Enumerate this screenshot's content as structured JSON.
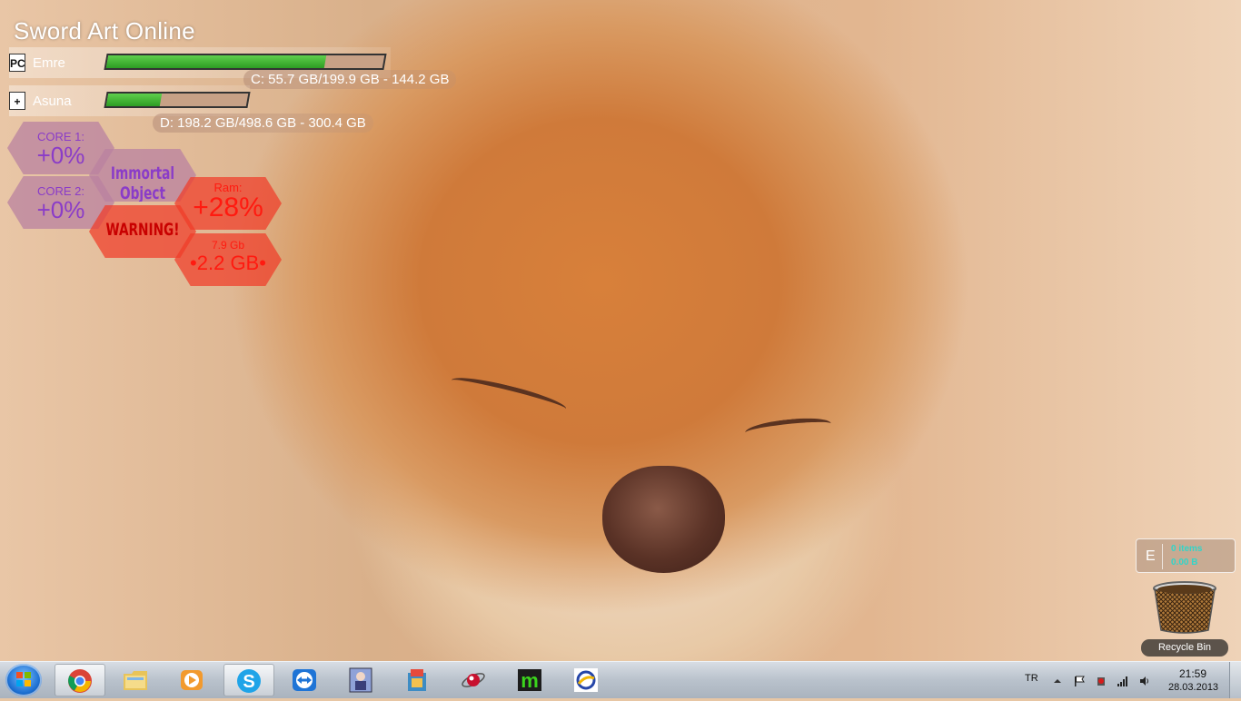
{
  "sao": {
    "title": "Sword Art Online",
    "players": [
      {
        "name": "Emre",
        "icon": "PC",
        "bar_fill": 0.79
      },
      {
        "name": "Asuna",
        "icon": "+",
        "bar_fill": 0.38
      }
    ],
    "disks": [
      {
        "text": "C: 55.7 GB/199.9 GB - 144.2 GB",
        "used_fraction": 0.28
      },
      {
        "text": "D: 198.2 GB/498.6 GB - 300.4 GB",
        "used_fraction": 0.4
      }
    ]
  },
  "monitor": {
    "core1_label": "CORE 1:",
    "core1_value": "+0%",
    "core2_label": "CORE 2:",
    "core2_value": "+0%",
    "immortal": "Immortal Object",
    "warning": "WARNING!",
    "ram_label": "Ram:",
    "ram_value": "+28%",
    "mem_total": "7.9 Gb",
    "mem_free": "•2.2 GB•"
  },
  "recycle_bin": {
    "drive": "E",
    "items": "0 items",
    "size": "0.00 B",
    "label": "Recycle Bin"
  },
  "taskbar": {
    "apps": [
      {
        "name": "Google Chrome",
        "icon": "chrome-icon",
        "active": true
      },
      {
        "name": "Windows Explorer",
        "icon": "folder-icon",
        "active": false
      },
      {
        "name": "Media Player",
        "icon": "media-player-icon",
        "active": false
      },
      {
        "name": "Skype",
        "icon": "skype-icon",
        "active": true
      },
      {
        "name": "TeamViewer",
        "icon": "teamviewer-icon",
        "active": false
      },
      {
        "name": "Anime App",
        "icon": "anime-app-icon",
        "active": false
      },
      {
        "name": "Library",
        "icon": "library-icon",
        "active": false
      },
      {
        "name": "Media Orb",
        "icon": "orb-icon",
        "active": false
      },
      {
        "name": "Messenger",
        "icon": "m-icon",
        "active": false
      },
      {
        "name": "Browser",
        "icon": "globe-icon",
        "active": false
      }
    ],
    "language": "TR",
    "time": "21:59",
    "date": "28.03.2013"
  },
  "colors": {
    "hp_green": "#2d9d23",
    "hex_purple": "#8a3cc8",
    "hex_red": "#ff1a10",
    "bin_text": "#33d4c8"
  }
}
